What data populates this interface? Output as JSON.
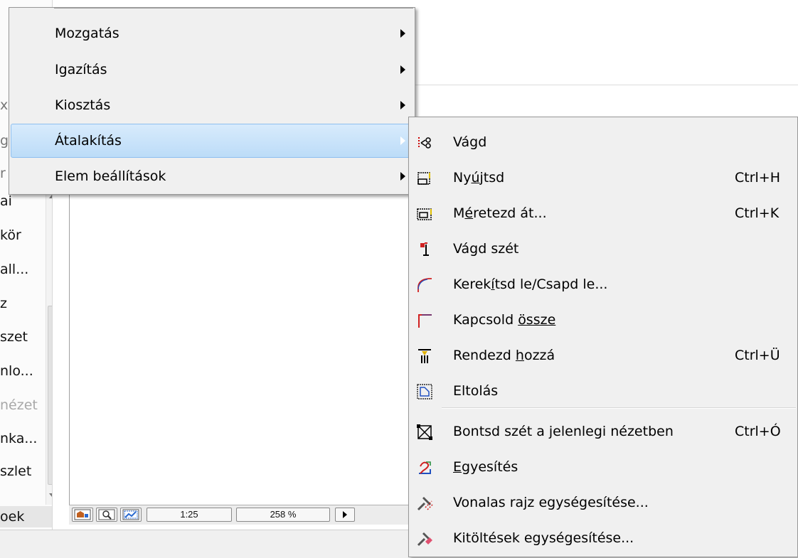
{
  "left_panel": {
    "items": [
      {
        "text": "ai"
      },
      {
        "text": "kör"
      },
      {
        "text": "all..."
      },
      {
        "text": "z"
      },
      {
        "text": "szet"
      },
      {
        "text": "nlo..."
      },
      {
        "text": "nézet",
        "dim": true
      },
      {
        "text": "nka..."
      },
      {
        "text": "szlet"
      },
      {
        "text": "oek"
      }
    ],
    "fragments": [
      "x",
      "g",
      "r"
    ]
  },
  "status_bar": {
    "scale": "1:25",
    "zoom": "258 %"
  },
  "main_menu": {
    "items": [
      {
        "label": "Mozgatás",
        "has_submenu": true
      },
      {
        "label": "Igazítás",
        "has_submenu": true
      },
      {
        "label": "Kiosztás",
        "has_submenu": true
      },
      {
        "label": "Átalakítás",
        "has_submenu": true,
        "highlighted": true
      },
      {
        "label": "Elem beállítások",
        "has_submenu": true
      }
    ]
  },
  "sub_menu": {
    "items": [
      {
        "pre": "",
        "u": "",
        "post": "Vágd",
        "shortcut": "",
        "icon": "trim-icon"
      },
      {
        "pre": "Ny",
        "u": "ú",
        "post": "jtsd",
        "shortcut": "Ctrl+H",
        "icon": "stretch-icon"
      },
      {
        "pre": "M",
        "u": "é",
        "post": "retezd át...",
        "shortcut": "Ctrl+K",
        "icon": "resize-icon"
      },
      {
        "pre": "",
        "u": "",
        "post": "Vágd szét",
        "shortcut": "",
        "icon": "split-icon"
      },
      {
        "pre": "Kerek",
        "u": "í",
        "post": "tsd le/Csapd le...",
        "shortcut": "",
        "icon": "fillet-icon"
      },
      {
        "pre": "Kapcsold ",
        "u": "össze",
        "post": "",
        "shortcut": "",
        "icon": "connect-icon"
      },
      {
        "pre": "Rendezd ",
        "u": "h",
        "post": "ozzá",
        "shortcut": "Ctrl+Ü",
        "icon": "adjust-icon"
      },
      {
        "pre": "",
        "u": "",
        "post": "Eltolás",
        "shortcut": "",
        "icon": "offset-icon"
      },
      {
        "pre": "Bontsd szét a ",
        "u": "j",
        "post": "elenlegi nézetben",
        "shortcut": "Ctrl+Ó",
        "icon": "explode-icon"
      },
      {
        "pre": "",
        "u": "E",
        "post": "gyesítés",
        "shortcut": "",
        "icon": "merge-icon"
      },
      {
        "pre": "",
        "u": "",
        "post": "Vonalas rajz egységesítése...",
        "shortcut": "",
        "icon": "unify-lines-icon"
      },
      {
        "pre": "",
        "u": "",
        "post": "Kitöltések egységesítése...",
        "shortcut": "",
        "icon": "unify-fills-icon"
      }
    ]
  }
}
